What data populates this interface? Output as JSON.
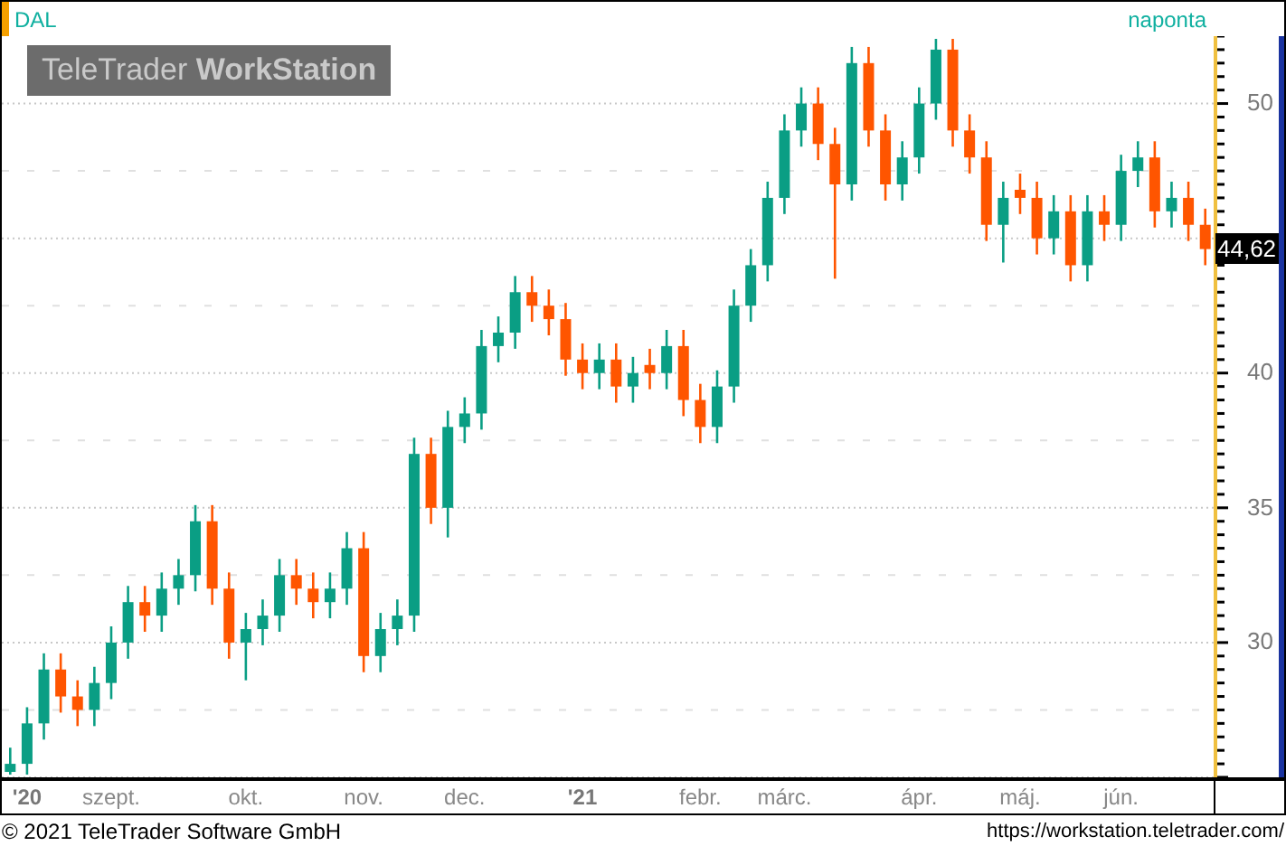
{
  "symbol": "DAL",
  "interval": "naponta",
  "logo": "TeleTrader **WorkStation**",
  "last_price": "44,62",
  "chart_data": {
    "type": "candlestick",
    "grid": true,
    "ylim": [
      25,
      52.5
    ],
    "yticks": [
      {
        "value": 30,
        "label": "30"
      },
      {
        "value": 35,
        "label": "35"
      },
      {
        "value": 40,
        "label": "40"
      },
      {
        "value": 50,
        "label": "50"
      }
    ],
    "categories": [
      null,
      "**'20**",
      null,
      null,
      null,
      null,
      "szept.",
      null,
      null,
      null,
      null,
      null,
      null,
      null,
      "okt.",
      null,
      null,
      null,
      null,
      null,
      null,
      "nov.",
      null,
      null,
      null,
      null,
      null,
      "dec.",
      null,
      null,
      null,
      null,
      null,
      null,
      "**'21**",
      null,
      null,
      null,
      null,
      null,
      null,
      "febr.",
      null,
      null,
      null,
      null,
      "márc.",
      null,
      null,
      null,
      null,
      null,
      null,
      null,
      "ápr.",
      null,
      null,
      null,
      null,
      null,
      "máj.",
      null,
      null,
      null,
      null,
      null,
      "jún.",
      null,
      null,
      null,
      null,
      null
    ],
    "ohlc": [
      [
        25.2,
        26.1,
        25.1,
        25.5
      ],
      [
        25.5,
        27.6,
        25.1,
        27
      ],
      [
        27,
        29.6,
        26.4,
        29
      ],
      [
        29,
        29.6,
        27.4,
        28
      ],
      [
        28,
        28.6,
        26.9,
        27.5
      ],
      [
        27.5,
        29.1,
        26.9,
        28.5
      ],
      [
        28.5,
        30.6,
        27.9,
        30
      ],
      [
        30,
        32.1,
        29.4,
        31.5
      ],
      [
        31.5,
        32.1,
        30.4,
        31
      ],
      [
        31,
        32.6,
        30.4,
        32
      ],
      [
        32,
        33.1,
        31.4,
        32.5
      ],
      [
        32.5,
        35.1,
        31.9,
        34.5
      ],
      [
        34.5,
        35.1,
        31.4,
        32
      ],
      [
        32,
        32.6,
        29.4,
        30
      ],
      [
        30,
        31.1,
        28.6,
        30.5
      ],
      [
        30.5,
        31.6,
        29.9,
        31
      ],
      [
        31,
        33.1,
        30.4,
        32.5
      ],
      [
        32.5,
        33.1,
        31.4,
        32
      ],
      [
        32,
        32.6,
        30.9,
        31.5
      ],
      [
        31.5,
        32.6,
        30.9,
        32
      ],
      [
        32,
        34.1,
        31.4,
        33.5
      ],
      [
        33.5,
        34.1,
        28.9,
        29.5
      ],
      [
        29.5,
        31.1,
        28.9,
        30.5
      ],
      [
        30.5,
        31.6,
        29.9,
        31
      ],
      [
        31,
        37.6,
        30.4,
        37
      ],
      [
        37,
        37.6,
        34.4,
        35
      ],
      [
        35,
        38.6,
        33.9,
        38
      ],
      [
        38,
        39.1,
        37.4,
        38.5
      ],
      [
        38.5,
        41.6,
        37.9,
        41
      ],
      [
        41,
        42.1,
        40.4,
        41.5
      ],
      [
        41.5,
        43.6,
        40.9,
        43
      ],
      [
        43,
        43.6,
        41.9,
        42.5
      ],
      [
        42.5,
        43.1,
        41.4,
        42
      ],
      [
        42,
        42.6,
        39.9,
        40.5
      ],
      [
        40.5,
        41.1,
        39.4,
        40
      ],
      [
        40,
        41.1,
        39.4,
        40.5
      ],
      [
        40.5,
        41.1,
        38.9,
        39.5
      ],
      [
        39.5,
        40.6,
        38.9,
        40
      ],
      [
        40.3,
        40.9,
        39.4,
        40
      ],
      [
        40,
        41.6,
        39.4,
        41
      ],
      [
        41,
        41.6,
        38.4,
        39
      ],
      [
        39,
        39.6,
        37.4,
        38
      ],
      [
        38,
        40.1,
        37.4,
        39.5
      ],
      [
        39.5,
        43.1,
        38.9,
        42.5
      ],
      [
        42.5,
        44.6,
        41.9,
        44
      ],
      [
        44,
        47.1,
        43.4,
        46.5
      ],
      [
        46.5,
        49.6,
        45.9,
        49
      ],
      [
        49,
        50.6,
        48.4,
        50
      ],
      [
        50,
        50.6,
        47.9,
        48.5
      ],
      [
        48.5,
        49.1,
        43.5,
        47
      ],
      [
        47,
        52.1,
        46.4,
        51.5
      ],
      [
        51.5,
        52.1,
        48.4,
        49
      ],
      [
        49,
        49.6,
        46.4,
        47
      ],
      [
        47,
        48.6,
        46.4,
        48
      ],
      [
        48,
        50.6,
        47.4,
        50
      ],
      [
        50,
        52.4,
        49.4,
        52
      ],
      [
        52,
        52.4,
        48.4,
        49
      ],
      [
        49,
        49.6,
        47.4,
        48
      ],
      [
        48,
        48.6,
        44.9,
        45.5
      ],
      [
        45.5,
        47.1,
        44.1,
        46.5
      ],
      [
        46.8,
        47.4,
        45.9,
        46.5
      ],
      [
        46.5,
        47.1,
        44.4,
        45
      ],
      [
        45,
        46.6,
        44.4,
        46
      ],
      [
        46,
        46.6,
        43.4,
        44
      ],
      [
        44,
        46.6,
        43.4,
        46
      ],
      [
        46,
        46.6,
        44.9,
        45.5
      ],
      [
        45.5,
        48.1,
        44.9,
        47.5
      ],
      [
        47.5,
        48.6,
        46.9,
        48
      ],
      [
        48,
        48.6,
        45.4,
        46
      ],
      [
        46,
        47.1,
        45.4,
        46.5
      ],
      [
        46.5,
        47.1,
        44.9,
        45.5
      ],
      [
        45.5,
        46.1,
        44.0,
        44.6
      ]
    ]
  },
  "copyright": "© 2021 TeleTrader Software GmbH",
  "url": "https://workstation.teletrader.com/"
}
